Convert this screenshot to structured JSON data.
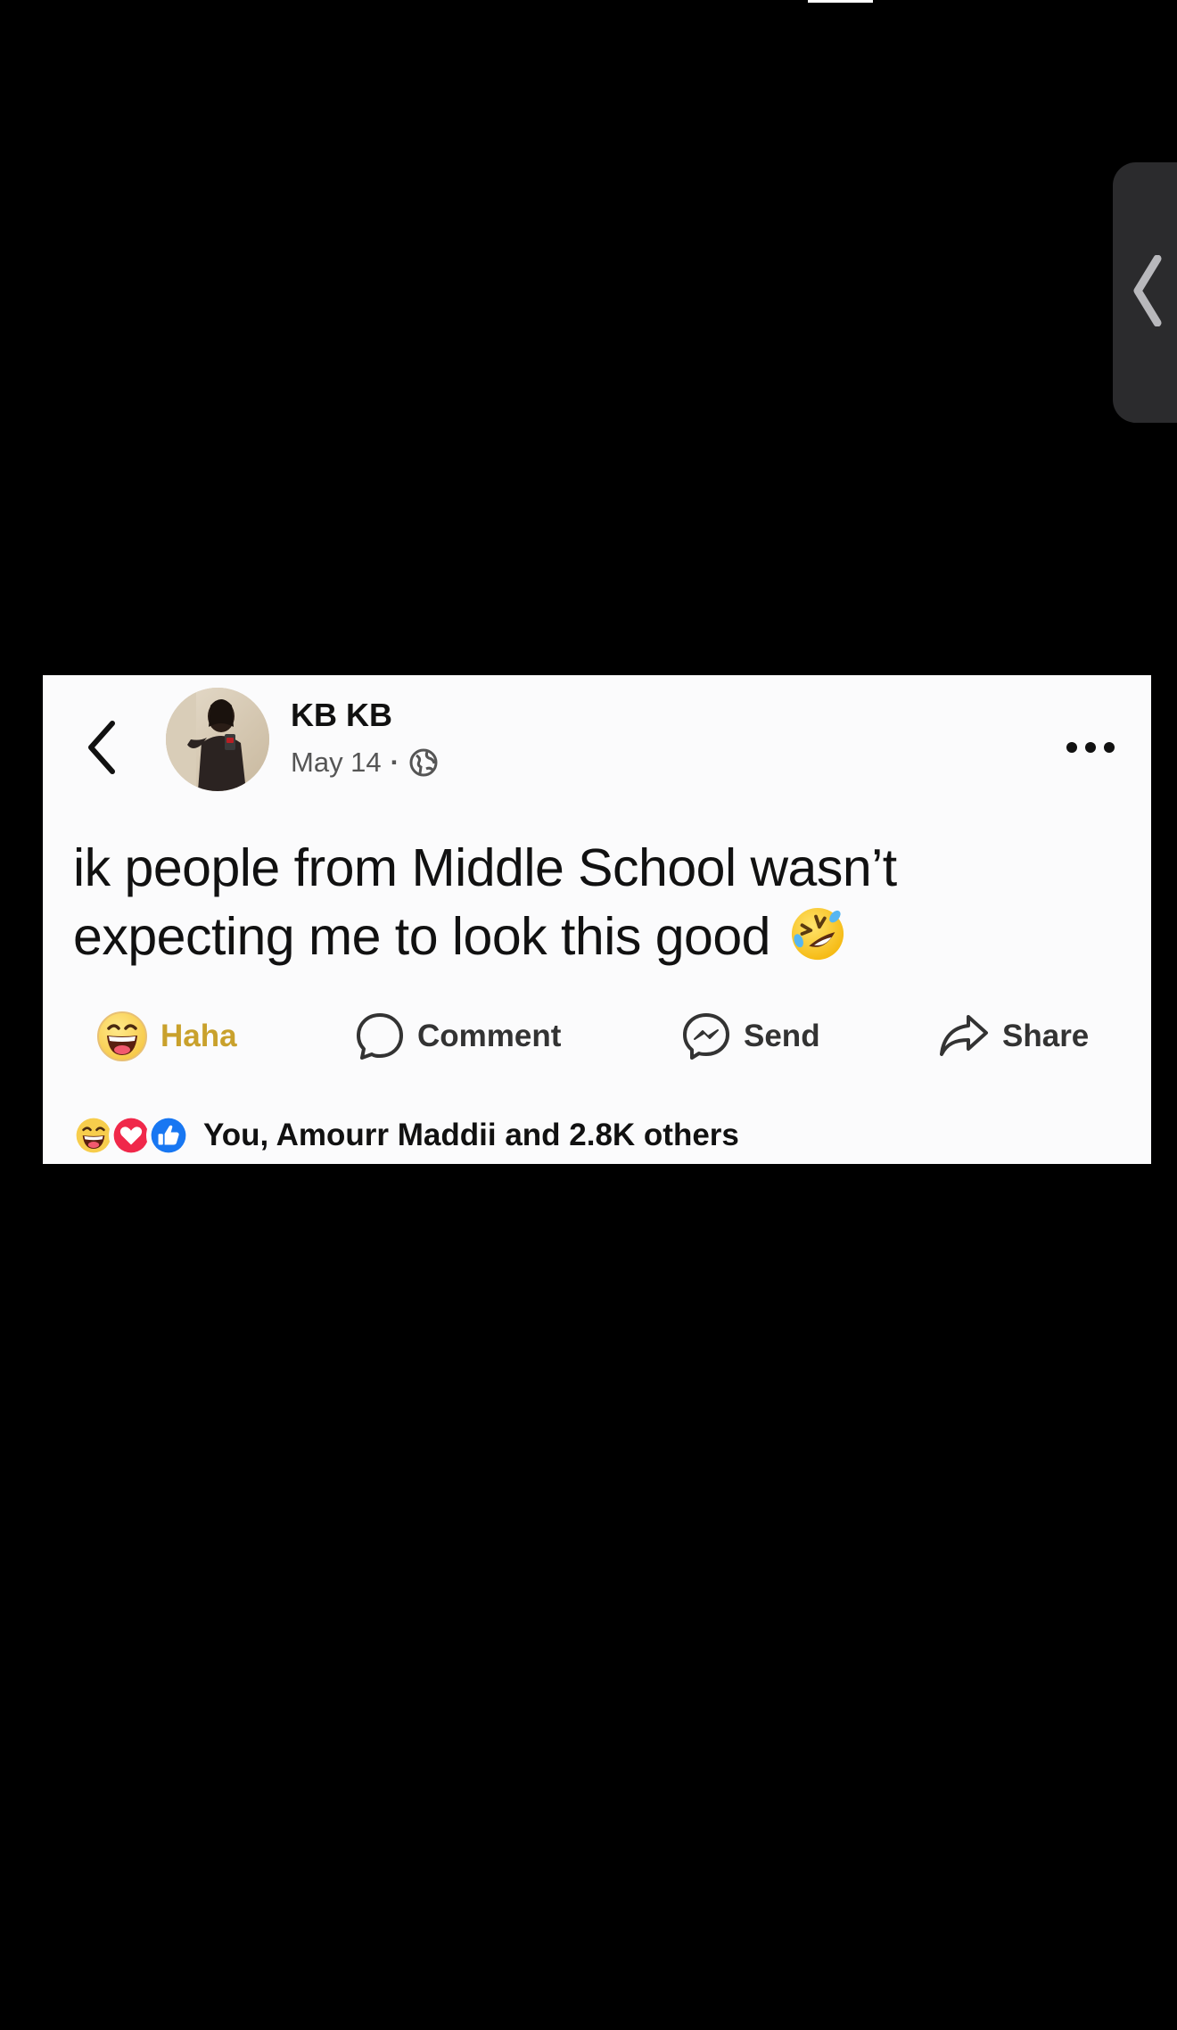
{
  "post": {
    "author": "KB KB",
    "date": "May 14",
    "separator": "·",
    "privacy_icon": "globe-icon",
    "text": "ik people from Middle School wasn’t expecting me to look this good",
    "text_emoji": "rolling-on-floor-laughing-emoji"
  },
  "actions": {
    "haha_label": "Haha",
    "comment_label": "Comment",
    "send_label": "Send",
    "share_label": "Share"
  },
  "reactions": {
    "summary": "You, Amourr Maddii and 2.8K others",
    "icons": [
      "haha-reaction-icon",
      "love-reaction-icon",
      "like-reaction-icon"
    ]
  },
  "colors": {
    "page_background": "#000000",
    "card_background": "#fbfbfc",
    "haha_active": "#c9a12c",
    "like_blue": "#1877f2",
    "love_red": "#f0284a",
    "edge_handle": "#2b2b2d"
  }
}
